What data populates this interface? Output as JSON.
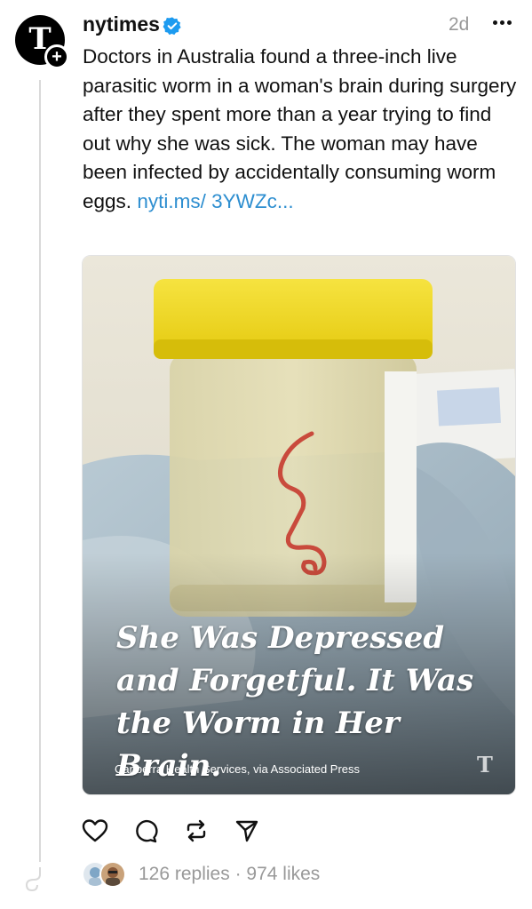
{
  "post": {
    "username": "nytimes",
    "timestamp": "2d",
    "text": "Doctors in Australia found a three-inch live parasitic worm in a woman's brain during surgery after they spent more than a year trying to find out why she was sick. The woman may have been infected by accidentally consuming worm eggs.",
    "link_text": "nyti.ms/ 3YWZc...",
    "avatar_glyph": "T",
    "follow_badge": "+",
    "verified": true
  },
  "media": {
    "headline": "She Was Depressed and Forgetful. It Was the Worm in Her Brain.",
    "credit": "Canberra Health Services, via Associated Press",
    "logo_glyph": "T"
  },
  "actions": {
    "icons": [
      "heart-icon",
      "comment-icon",
      "repost-icon",
      "share-icon"
    ]
  },
  "stats": {
    "replies": "126 replies",
    "separator": " · ",
    "likes": "974 likes"
  },
  "colors": {
    "link": "#2d8ed0",
    "verified": "#1d9bf0",
    "muted": "#999999",
    "cap_yellow": "#f2da1a"
  }
}
